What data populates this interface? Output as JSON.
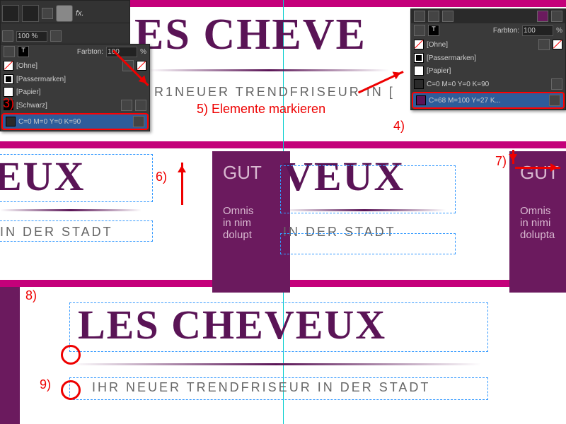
{
  "annotations": {
    "a3": "3)",
    "a4": "4)",
    "a5": "5) Elemente markieren",
    "a6": "6)",
    "a7": "7)",
    "a8": "8)",
    "a9": "9)"
  },
  "panelLeft": {
    "farbton_label": "Farbton:",
    "farbton_value": "100",
    "swatches": [
      "[Ohne]",
      "[Passermarken]",
      "[Papier]",
      "[Schwarz]",
      "C=0 M=0 Y=0 K=90"
    ]
  },
  "panelRight": {
    "farbton_label": "Farbton:",
    "farbton_value": "100",
    "swatches": [
      "[Ohne]",
      "[Passermarken]",
      "[Papier]",
      "C=0 M=0 Y=0 K=90",
      "C=68 M=100 Y=27 K..."
    ]
  },
  "fx": {
    "opacity": "100 %",
    "fx": "fx."
  },
  "text": {
    "title_top": "ES CHEVE",
    "subtitle_top": "R1NEUER TRENDFRISEUR IN [",
    "title_mid": "EUX",
    "title_mid2": "VEUX",
    "sub_mid": "IN DER STADT",
    "sub_mid2": "IN DER STADT",
    "gut": "GUT",
    "gut2": "GUT",
    "lorem": "Omnis",
    "lorem2": "in nim",
    "lorem3": "dolupt",
    "loremb": "Omnis",
    "loremb2": "in nimi",
    "loremb3": "dolupta",
    "title_bot": "LES CHEVEUX",
    "sub_bot": "IHR NEUER TRENDFRISEUR IN DER STADT"
  }
}
